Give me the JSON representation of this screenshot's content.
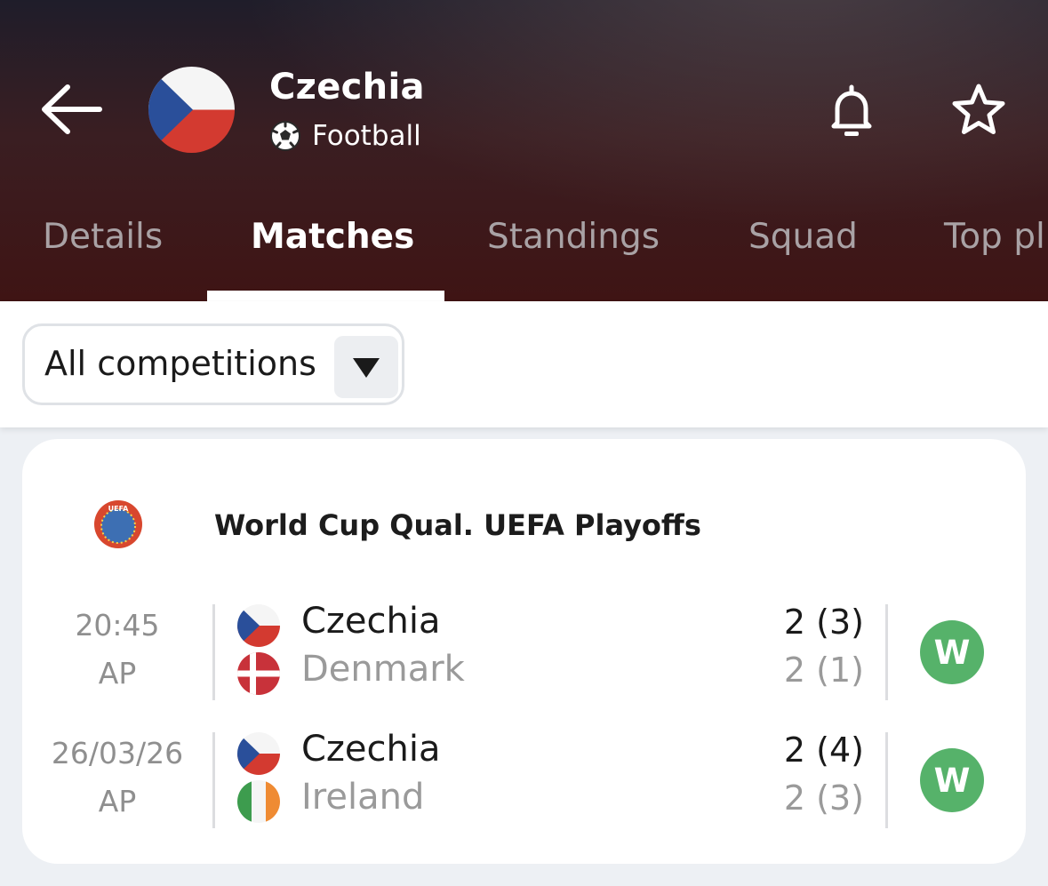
{
  "header": {
    "team_name": "Czechia",
    "sport": "Football",
    "icons": {
      "back": "arrow-left-icon",
      "notifications": "bell-icon",
      "favorite": "star-icon",
      "sport": "soccer-ball-icon"
    }
  },
  "tabs": [
    {
      "label": "Details",
      "active": false
    },
    {
      "label": "Matches",
      "active": true
    },
    {
      "label": "Standings",
      "active": false
    },
    {
      "label": "Squad",
      "active": false
    },
    {
      "label": "Top pl",
      "active": false
    }
  ],
  "filter": {
    "selected": "All competitions",
    "icon": "dropdown-triangle-icon"
  },
  "competition": {
    "name": "World Cup Qual. UEFA Playoffs",
    "logo_icon": "uefa-logo-icon",
    "logo_text": "UEFA"
  },
  "matches": [
    {
      "date": "20:45",
      "status": "AP",
      "home": {
        "name": "Czechia",
        "score": "2 (3)",
        "flag": "czechia-flag"
      },
      "away": {
        "name": "Denmark",
        "score": "2 (1)",
        "flag": "denmark-flag"
      },
      "result": "W"
    },
    {
      "date": "26/03/26",
      "status": "AP",
      "home": {
        "name": "Czechia",
        "score": "2 (4)",
        "flag": "czechia-flag"
      },
      "away": {
        "name": "Ireland",
        "score": "2 (3)",
        "flag": "ireland-flag"
      },
      "result": "W"
    }
  ],
  "colors": {
    "win_badge": "#56b26a",
    "header_dark": "#3f1414",
    "czech_blue": "#2a4f9a",
    "czech_red": "#d33a30",
    "denmark_red": "#c8323a",
    "ireland_green": "#3d9c4e",
    "ireland_orange": "#ef8b33"
  }
}
